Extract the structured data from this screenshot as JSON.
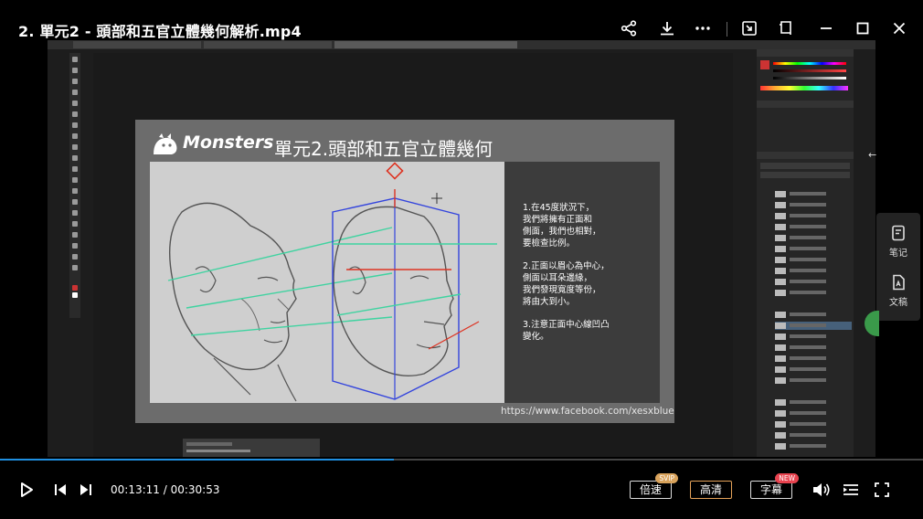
{
  "window": {
    "title": "2. 單元2 - 頭部和五官立體幾何解析.mp4"
  },
  "slide": {
    "logo_text": "Monsters",
    "heading": "單元2.頭部和五官立體幾何",
    "notes": [
      "1.在45度狀況下，\n我們將擁有正面和\n側面，我們也相對，\n要檢查比例。",
      "2.正面以眉心為中心，\n側面以耳朵邊緣，\n我們發現寬度等份，\n將由大到小。",
      "3.注意正面中心線凹凸\n變化。"
    ],
    "url": "https://www.facebook.com/xesxblue"
  },
  "side_panel": {
    "notes_label": "笔记",
    "transcript_label": "文稿"
  },
  "player": {
    "current_time": "00:13:11",
    "separator": " / ",
    "total_time": "00:30:53",
    "progress_fraction": 0.427,
    "speed_label": "倍速",
    "speed_badge": "SVIP",
    "quality_label": "高清",
    "subtitle_label": "字幕",
    "subtitle_badge": "NEW"
  },
  "colors": {
    "progress": "#1f8fe0",
    "quality_border": "#e5a35a",
    "svip_badge": "#d9a35c",
    "new_badge": "#e8434f",
    "guide_green": "#3fd3a0",
    "guide_blue": "#3344dd",
    "guide_red": "#dd3322"
  }
}
